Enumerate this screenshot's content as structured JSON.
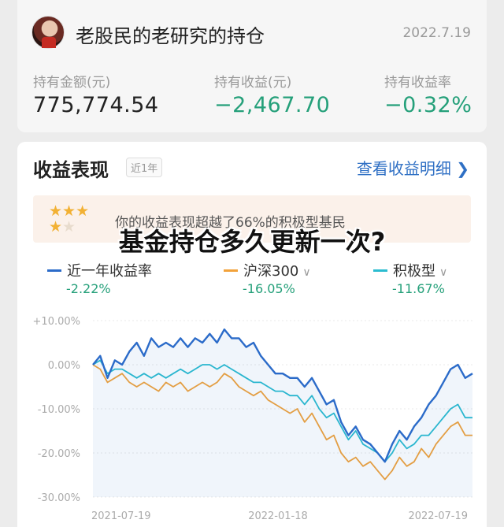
{
  "header": {
    "account_title": "老股民的老研究的持仓",
    "date": "2022.7.19"
  },
  "stats": [
    {
      "label": "持有金额(元)",
      "value": "775,774.54"
    },
    {
      "label": "持有收益(元)",
      "value": "−2,467.70"
    },
    {
      "label": "持有收益率",
      "value": "−0.32%"
    }
  ],
  "performance": {
    "title": "收益表现",
    "period_tag": "近1年",
    "detail_link": "查看收益明细",
    "rank_text": "你的收益表现超越了66%的积极型基民",
    "stars_filled": 4,
    "stars_total": 5
  },
  "overlay_title": "基金持仓多久更新一次?",
  "colors": {
    "accent_blue": "#2e6fc4",
    "positive_green": "#25a07a",
    "series_blue": "#2b6bc9",
    "series_orange": "#f2a23a",
    "series_teal": "#2bbcd0"
  },
  "chart_data": {
    "type": "line",
    "x_ticks": [
      "2021-07-19",
      "2022-01-18",
      "2022-07-19"
    ],
    "y_ticks": [
      "+10.00%",
      "0.00%",
      "-10.00%",
      "-20.00%",
      "-30.00%"
    ],
    "ylim": [
      -30,
      10
    ],
    "grid": true,
    "legend_position": "top",
    "series": [
      {
        "name": "近一年收益率",
        "final": "-2.22%",
        "color": "#2b6bc9",
        "values": [
          0,
          2,
          -3,
          1,
          0,
          3,
          5,
          2,
          6,
          4,
          5,
          4,
          6,
          4,
          6,
          5,
          7,
          5,
          8,
          6,
          6,
          4,
          5,
          2,
          0,
          -2,
          -2,
          -3,
          -3,
          -5,
          -3,
          -6,
          -9,
          -8,
          -13,
          -16,
          -14,
          -17,
          -18,
          -20,
          -22,
          -18,
          -15,
          -17,
          -14,
          -12,
          -9,
          -7,
          -4,
          -1,
          0,
          -3,
          -2
        ]
      },
      {
        "name": "沪深300",
        "final": "-16.05%",
        "color": "#f2a23a",
        "values": [
          0,
          -1,
          -4,
          -3,
          -2,
          -4,
          -5,
          -4,
          -5,
          -6,
          -4,
          -5,
          -4,
          -6,
          -5,
          -4,
          -5,
          -4,
          -2,
          -3,
          -5,
          -6,
          -7,
          -6,
          -8,
          -9,
          -10,
          -11,
          -10,
          -13,
          -11,
          -14,
          -17,
          -16,
          -20,
          -22,
          -21,
          -23,
          -22,
          -24,
          -26,
          -24,
          -21,
          -23,
          -22,
          -19,
          -21,
          -18,
          -16,
          -14,
          -13,
          -16,
          -16
        ]
      },
      {
        "name": "积极型",
        "final": "-11.67%",
        "color": "#2bbcd0",
        "values": [
          0,
          1,
          -2,
          -1,
          -1,
          -2,
          -3,
          -2,
          -3,
          -2,
          -3,
          -2,
          -1,
          -2,
          -1,
          0,
          0,
          -1,
          0,
          -1,
          -2,
          -3,
          -4,
          -4,
          -5,
          -6,
          -6,
          -7,
          -7,
          -9,
          -7,
          -10,
          -12,
          -11,
          -14,
          -17,
          -15,
          -18,
          -19,
          -20,
          -22,
          -20,
          -17,
          -19,
          -18,
          -16,
          -16,
          -14,
          -12,
          -10,
          -9,
          -12,
          -12
        ]
      }
    ]
  }
}
